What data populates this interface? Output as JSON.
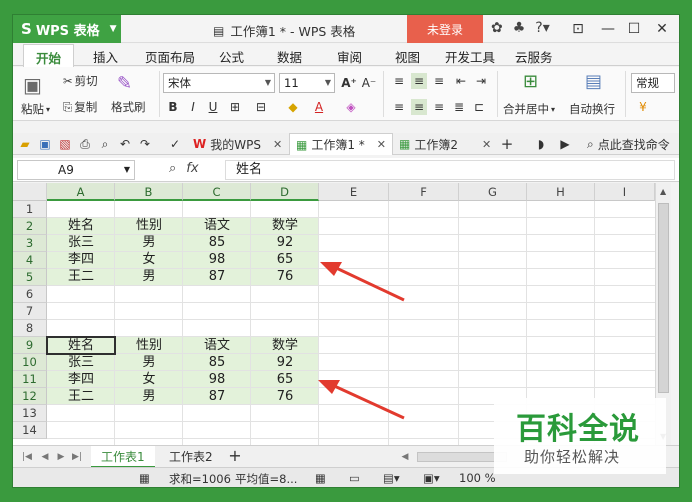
{
  "app": {
    "menu_label": "WPS 表格",
    "logo_glyph": "S"
  },
  "window": {
    "title": "工作簿1 * - WPS 表格",
    "login_label": "未登录",
    "help_label": "?"
  },
  "ribbon_tabs": [
    "开始",
    "插入",
    "页面布局",
    "公式",
    "数据",
    "审阅",
    "视图",
    "开发工具",
    "云服务"
  ],
  "ribbon": {
    "paste_label": "粘贴",
    "cut_label": "剪切",
    "copy_label": "复制",
    "format_painter_label": "格式刷",
    "font_name": "宋体",
    "font_size": "11",
    "merge_center_label": "合并居中",
    "wrap_text_label": "自动换行",
    "number_format": "常规"
  },
  "doc_tabs": [
    {
      "label": "我的WPS"
    },
    {
      "label": "工作簿1 *"
    },
    {
      "label": "工作簿2"
    }
  ],
  "search_label": "点此查找命令",
  "formula_bar": {
    "cell_ref": "A9",
    "fx_label": "fx",
    "value": "姓名"
  },
  "columns": [
    "A",
    "B",
    "C",
    "D",
    "E",
    "F",
    "G",
    "H",
    "I"
  ],
  "rows": [
    "1",
    "2",
    "3",
    "4",
    "5",
    "6",
    "7",
    "8",
    "9",
    "10",
    "11",
    "12",
    "13",
    "14"
  ],
  "table_top": {
    "headers": [
      "姓名",
      "性别",
      "语文",
      "数学"
    ],
    "rows": [
      [
        "张三",
        "男",
        "85",
        "92"
      ],
      [
        "李四",
        "女",
        "98",
        "65"
      ],
      [
        "王二",
        "男",
        "87",
        "76"
      ]
    ]
  },
  "table_bottom": {
    "headers": [
      "姓名",
      "性别",
      "语文",
      "数学"
    ],
    "rows": [
      [
        "张三",
        "男",
        "85",
        "92"
      ],
      [
        "李四",
        "女",
        "98",
        "65"
      ],
      [
        "王二",
        "男",
        "87",
        "76"
      ]
    ]
  },
  "sheets": [
    "工作表1",
    "工作表2"
  ],
  "status": {
    "sum": "求和=1006",
    "avg": "平均值=8...",
    "zoom": "100 %"
  },
  "watermark": {
    "main": "百科全说",
    "sub": "助你轻松解决"
  },
  "colors": {
    "accent": "#3fa243",
    "login": "#e8604c",
    "highlight": "#e3f2da",
    "arrow": "#e23a2e"
  }
}
